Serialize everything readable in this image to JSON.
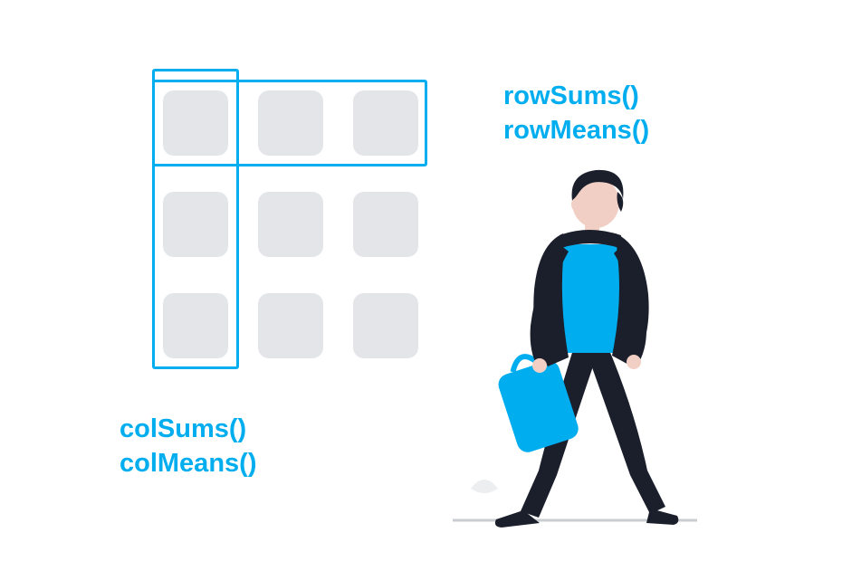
{
  "colors": {
    "accent": "#00aeef",
    "cell": "#e3e5e8",
    "skin": "#f2cfc4",
    "hair": "#1a1f2b",
    "clothes_dark": "#1a1f2b",
    "shirt": "#00aeef",
    "bag": "#00aeef",
    "ground": "#c9ccd1"
  },
  "labels": {
    "row_sums": "rowSums()",
    "row_means": "rowMeans()",
    "col_sums": "colSums()",
    "col_means": "colMeans()"
  },
  "grid": {
    "rows": 3,
    "cols": 3,
    "highlighted_row_index": 0,
    "highlighted_col_index": 0
  }
}
